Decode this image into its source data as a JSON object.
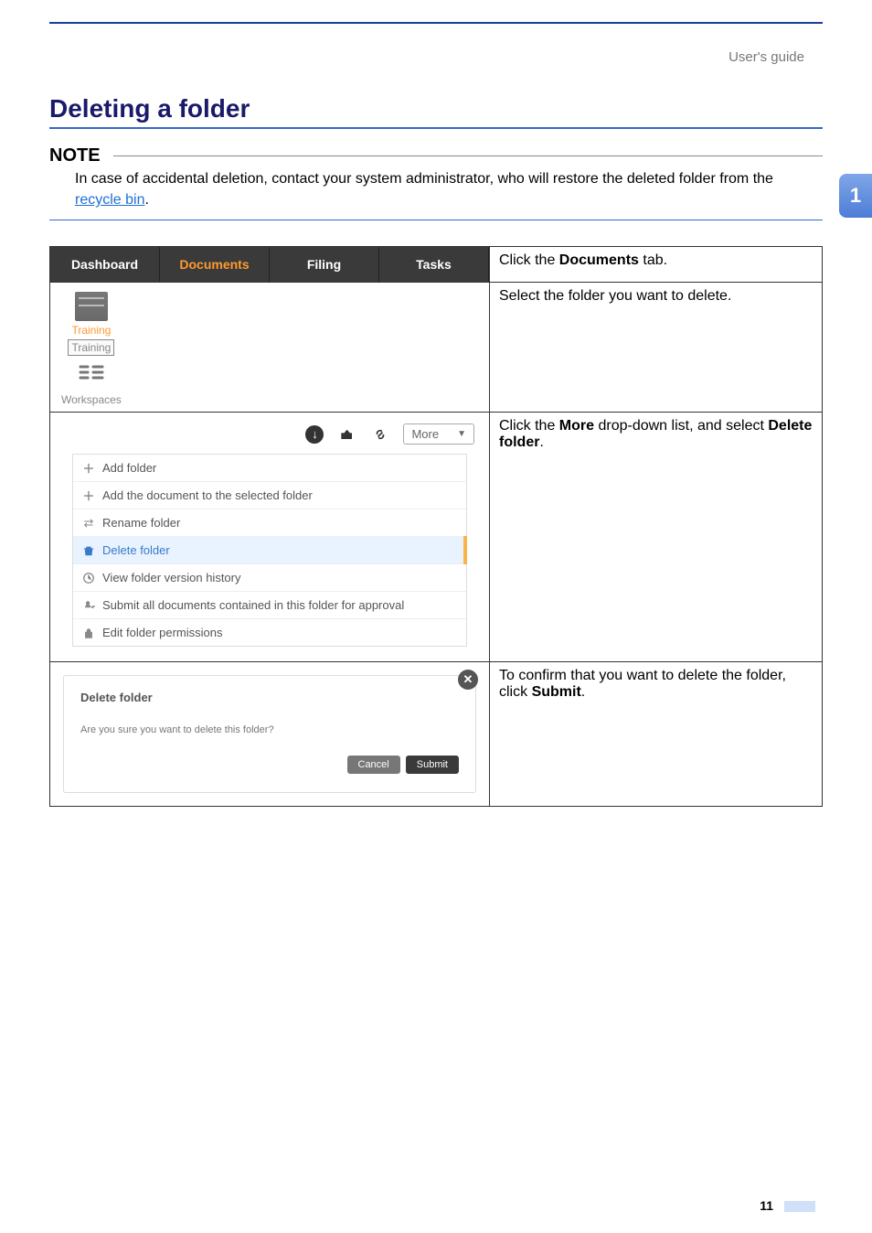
{
  "header": {
    "doc_type": "User's guide",
    "chapter_badge": "1"
  },
  "section": {
    "title": "Deleting a folder"
  },
  "note": {
    "label": "NOTE",
    "body_prefix": "In case of accidental deletion, contact your system administrator, who will restore the deleted folder from the ",
    "body_link": "recycle bin",
    "body_suffix": "."
  },
  "steps": [
    {
      "instruction_parts": [
        "Click the ",
        "Documents",
        " tab."
      ]
    },
    {
      "instruction_parts": [
        "Select the folder you want to delete."
      ]
    },
    {
      "instruction_parts": [
        "Click the ",
        "More",
        " drop-down list, and select ",
        "Delete folder",
        "."
      ]
    },
    {
      "instruction_parts": [
        "To confirm that you want to delete the folder, click ",
        "Submit",
        "."
      ]
    }
  ],
  "row1": {
    "tabs": [
      {
        "label": "Dashboard",
        "active": false
      },
      {
        "label": "Documents",
        "active": true
      },
      {
        "label": "Filing",
        "active": false
      },
      {
        "label": "Tasks",
        "active": false
      }
    ]
  },
  "row2": {
    "items": [
      {
        "label": "Training",
        "type": "folder",
        "selected": false
      },
      {
        "label": "Training",
        "type": "folder",
        "selected": true
      },
      {
        "label": "Workspaces",
        "type": "workspace",
        "selected": false
      }
    ]
  },
  "row3": {
    "more_button": "More",
    "menu": [
      {
        "label": "Add folder"
      },
      {
        "label": "Add the document to the selected folder"
      },
      {
        "label": "Rename folder"
      },
      {
        "label": "Delete folder",
        "highlight": true
      },
      {
        "label": "View folder version history"
      },
      {
        "label": "Submit all documents contained in this folder for approval"
      },
      {
        "label": "Edit folder permissions"
      }
    ]
  },
  "row4": {
    "title": "Delete folder",
    "question": "Are you sure you want to delete this folder?",
    "cancel": "Cancel",
    "submit": "Submit"
  },
  "page_number": "11"
}
